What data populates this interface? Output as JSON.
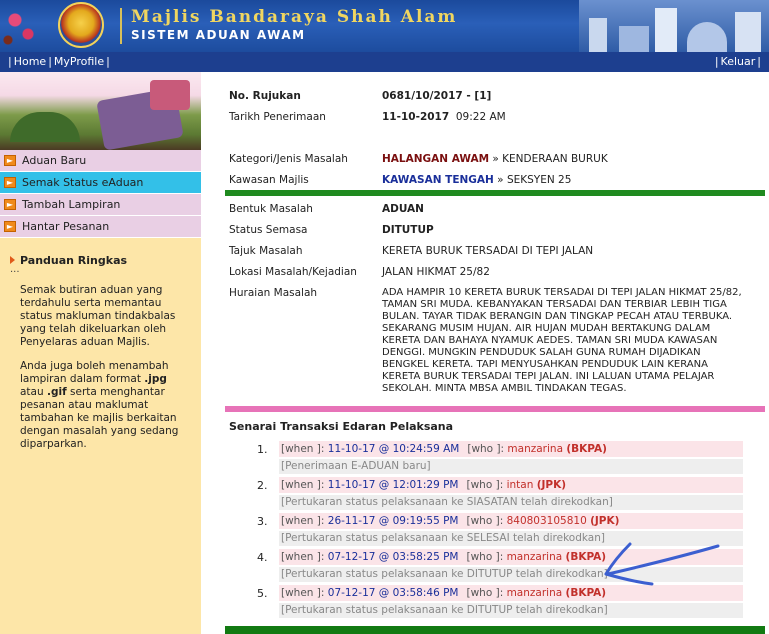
{
  "header": {
    "title": "Majlis Bandaraya Shah Alam",
    "subtitle": "SISTEM ADUAN AWAM"
  },
  "nav": {
    "home": "Home",
    "profile": "MyProfile",
    "logout": "Keluar"
  },
  "sidebar": {
    "menu": [
      {
        "label": "Aduan Baru",
        "active": false
      },
      {
        "label": "Semak Status eAduan",
        "active": true
      },
      {
        "label": "Tambah Lampiran",
        "active": false
      },
      {
        "label": "Hantar Pesanan",
        "active": false
      }
    ],
    "guide_title": "Panduan Ringkas",
    "guide_dots": "...",
    "guide_p1": "Semak butiran aduan yang terdahulu serta memantau status makluman tindakbalas yang telah dikeluarkan oleh Penyelaras aduan Majlis.",
    "guide_p2_a": "Anda juga boleh menambah lampiran dalam format ",
    "guide_p2_jpg": ".jpg",
    "guide_p2_b": " atau ",
    "guide_p2_gif": ".gif",
    "guide_p2_c": " serta menghantar pesanan atau maklumat tambahan ke majlis berkaitan dengan masalah yang sedang diparparkan."
  },
  "record": {
    "ref_label": "No. Rujukan",
    "ref_value": "0681/10/2017 - [1]",
    "date_label": "Tarikh Penerimaan",
    "date_value": "11-10-2017",
    "time_value": "09:22 AM",
    "category_label": "Kategori/Jenis Masalah",
    "category_main": "HALANGAN AWAM",
    "category_sep": " » ",
    "category_sub": "KENDERAAN BURUK",
    "area_label": "Kawasan Majlis",
    "area_main": "KAWASAN TENGAH",
    "area_sep": " » ",
    "area_sub": "SEKSYEN 25",
    "form_label": "Bentuk Masalah",
    "form_value": "ADUAN",
    "status_label": "Status Semasa",
    "status_value": "DITUTUP",
    "subject_label": "Tajuk Masalah",
    "subject_value": "KERETA BURUK TERSADAI DI TEPI JALAN",
    "location_label": "Lokasi Masalah/Kejadian",
    "location_value": "JALAN HIKMAT 25/82",
    "desc_label": "Huraian Masalah",
    "desc_value": "ADA HAMPIR 10 KERETA BURUK TERSADAI DI TEPI JALAN HIKMAT 25/82, TAMAN SRI MUDA. KEBANYAKAN TERSADAI DAN TERBIAR LEBIH TIGA BULAN. TAYAR TIDAK BERANGIN DAN TINGKAP PECAH ATAU TERBUKA. SEKARANG MUSIM HUJAN. AIR HUJAN MUDAH BERTAKUNG DALAM KERETA DAN BAHAYA NYAMUK AEDES. TAMAN SRI MUDA KAWASAN DENGGI. MUNGKIN PENDUDUK SALAH GUNA RUMAH DIJADIKAN BENGKEL KERETA. TAPI MENYUSAHKAN PENDUDUK LAIN KERANA KERETA BURUK TERSADAI TEPI JALAN. INI LALUAN UTAMA PELAJAR SEKOLAH. MINTA MBSA AMBIL TINDAKAN TEGAS."
  },
  "transactions": {
    "title": "Senarai Transaksi Edaran Pelaksana",
    "when_label": "[when ]: ",
    "who_label": "[who ]: ",
    "items": [
      {
        "num": "1.",
        "when": "11-10-17 @ 10:24:59 AM",
        "who": "manzarina",
        "dept": "(BKPA)",
        "note": "[Penerimaan E-ADUAN baru]"
      },
      {
        "num": "2.",
        "when": "11-10-17 @ 12:01:29 PM",
        "who": "intan",
        "dept": "(JPK)",
        "note": "[Pertukaran status pelaksanaan ke SIASATAN telah direkodkan]"
      },
      {
        "num": "3.",
        "when": "26-11-17 @ 09:19:55 PM",
        "who": "840803105810",
        "dept": "(JPK)",
        "note": "[Pertukaran status pelaksanaan ke SELESAI telah direkodkan]"
      },
      {
        "num": "4.",
        "when": "07-12-17 @ 03:58:25 PM",
        "who": "manzarina",
        "dept": "(BKPA)",
        "note": "[Pertukaran status pelaksanaan ke DITUTUP telah direkodkan]"
      },
      {
        "num": "5.",
        "when": "07-12-17 @ 03:58:46 PM",
        "who": "manzarina",
        "dept": "(BKPA)",
        "note": "[Pertukaran status pelaksanaan ke DITUTUP telah direkodkan]"
      }
    ]
  },
  "colors": {
    "header_blue": "#1b4a9c",
    "nav_blue": "#1d3f8f",
    "sidebar_bg": "#fde6a8",
    "menu_active": "#33c0e8",
    "green_bar": "#1f8a1f",
    "pink_bar": "#e773b8",
    "annotation_arrow": "#3c5fd0"
  },
  "icons": {
    "menu_arrow": "arrow-right-icon",
    "guide_bullet": "triangle-bullet-icon",
    "annotation": "hand-drawn-arrow-icon"
  }
}
